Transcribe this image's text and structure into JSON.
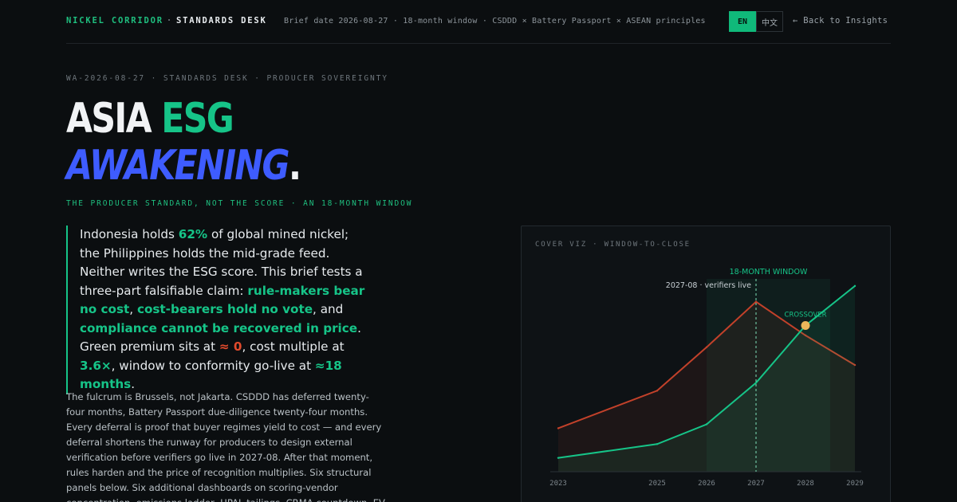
{
  "header": {
    "brand_primary": "NICKEL CORRIDOR",
    "brand_sep": "·",
    "brand_secondary": "STANDARDS DESK",
    "brief_meta": "Brief date 2026-08-27 · 18-month window · CSDDD × Battery Passport × ASEAN principles",
    "lang_en": "EN",
    "lang_zh": "中文",
    "back_link": "← Back to Insights"
  },
  "hero": {
    "kicker": "WA-2026-08-27 · STANDARDS DESK · PRODUCER SOVEREIGNTY",
    "title_word1": "ASIA",
    "title_word2": "ESG",
    "title_word3": "AWAKENING",
    "title_dot": ".",
    "subkicker": "THE PRODUCER STANDARD, NOT THE SCORE · AN 18-MONTH WINDOW"
  },
  "lede": {
    "t1": "Indonesia holds ",
    "h1": "62%",
    "t2": " of global mined nickel; the Philippines holds the mid-grade feed. Neither writes the ESG score. This brief tests a three-part falsifiable claim: ",
    "h2": "rule-makers bear no cost",
    "t3": ", ",
    "h3": "cost-bearers hold no vote",
    "t4": ", and ",
    "h4": "compliance cannot be recovered in price",
    "t5": ". Green premium sits at ",
    "h5": "≈ 0",
    "t6": ", cost multiple at ",
    "h6": "3.6×",
    "t7": ", window to conformity go-live at ",
    "h7": "≈18 months",
    "t8": "."
  },
  "body": {
    "text": "The fulcrum is Brussels, not Jakarta. CSDDD has deferred twenty-four months, Battery Passport due-diligence twenty-four months. Every deferral is proof that buyer regimes yield to cost — and every deferral shortens the runway for producers to design external verification before verifiers go live in 2027-08. After that moment, rules harden and the price of recognition multiplies. Six structural panels below. Six additional dashboards on scoring-vendor concentration, emissions ladder, HPAL tailings, CRMA countdown, EV battery demand and deep-sea licensing. Four international-"
  },
  "viz": {
    "title": "COVER VIZ · WINDOW-TO-CLOSE",
    "colors": {
      "red": "#c2412a",
      "green": "#16c488",
      "marker": "#eab65a"
    }
  },
  "chart_data": {
    "type": "line",
    "x": [
      2023,
      2025,
      2026,
      2027,
      2028,
      2029
    ],
    "x_ticks": [
      "2023",
      "2025",
      "2026",
      "2027",
      "2028",
      "2029"
    ],
    "xlim": [
      2023,
      2029
    ],
    "ylim": [
      0,
      100
    ],
    "series": [
      {
        "values": [
          22,
          41,
          63,
          86,
          69,
          54
        ]
      },
      {
        "values": [
          7,
          14,
          24,
          45,
          74,
          94
        ]
      }
    ],
    "window_band": {
      "label": "18-MONTH WINDOW",
      "start": 2026,
      "end": 2028.5
    },
    "vline": {
      "at": 2027,
      "label": "2027-08 · verifiers live"
    },
    "crossover": {
      "x": 2028,
      "y": 74,
      "label": "CROSSOVER"
    }
  }
}
